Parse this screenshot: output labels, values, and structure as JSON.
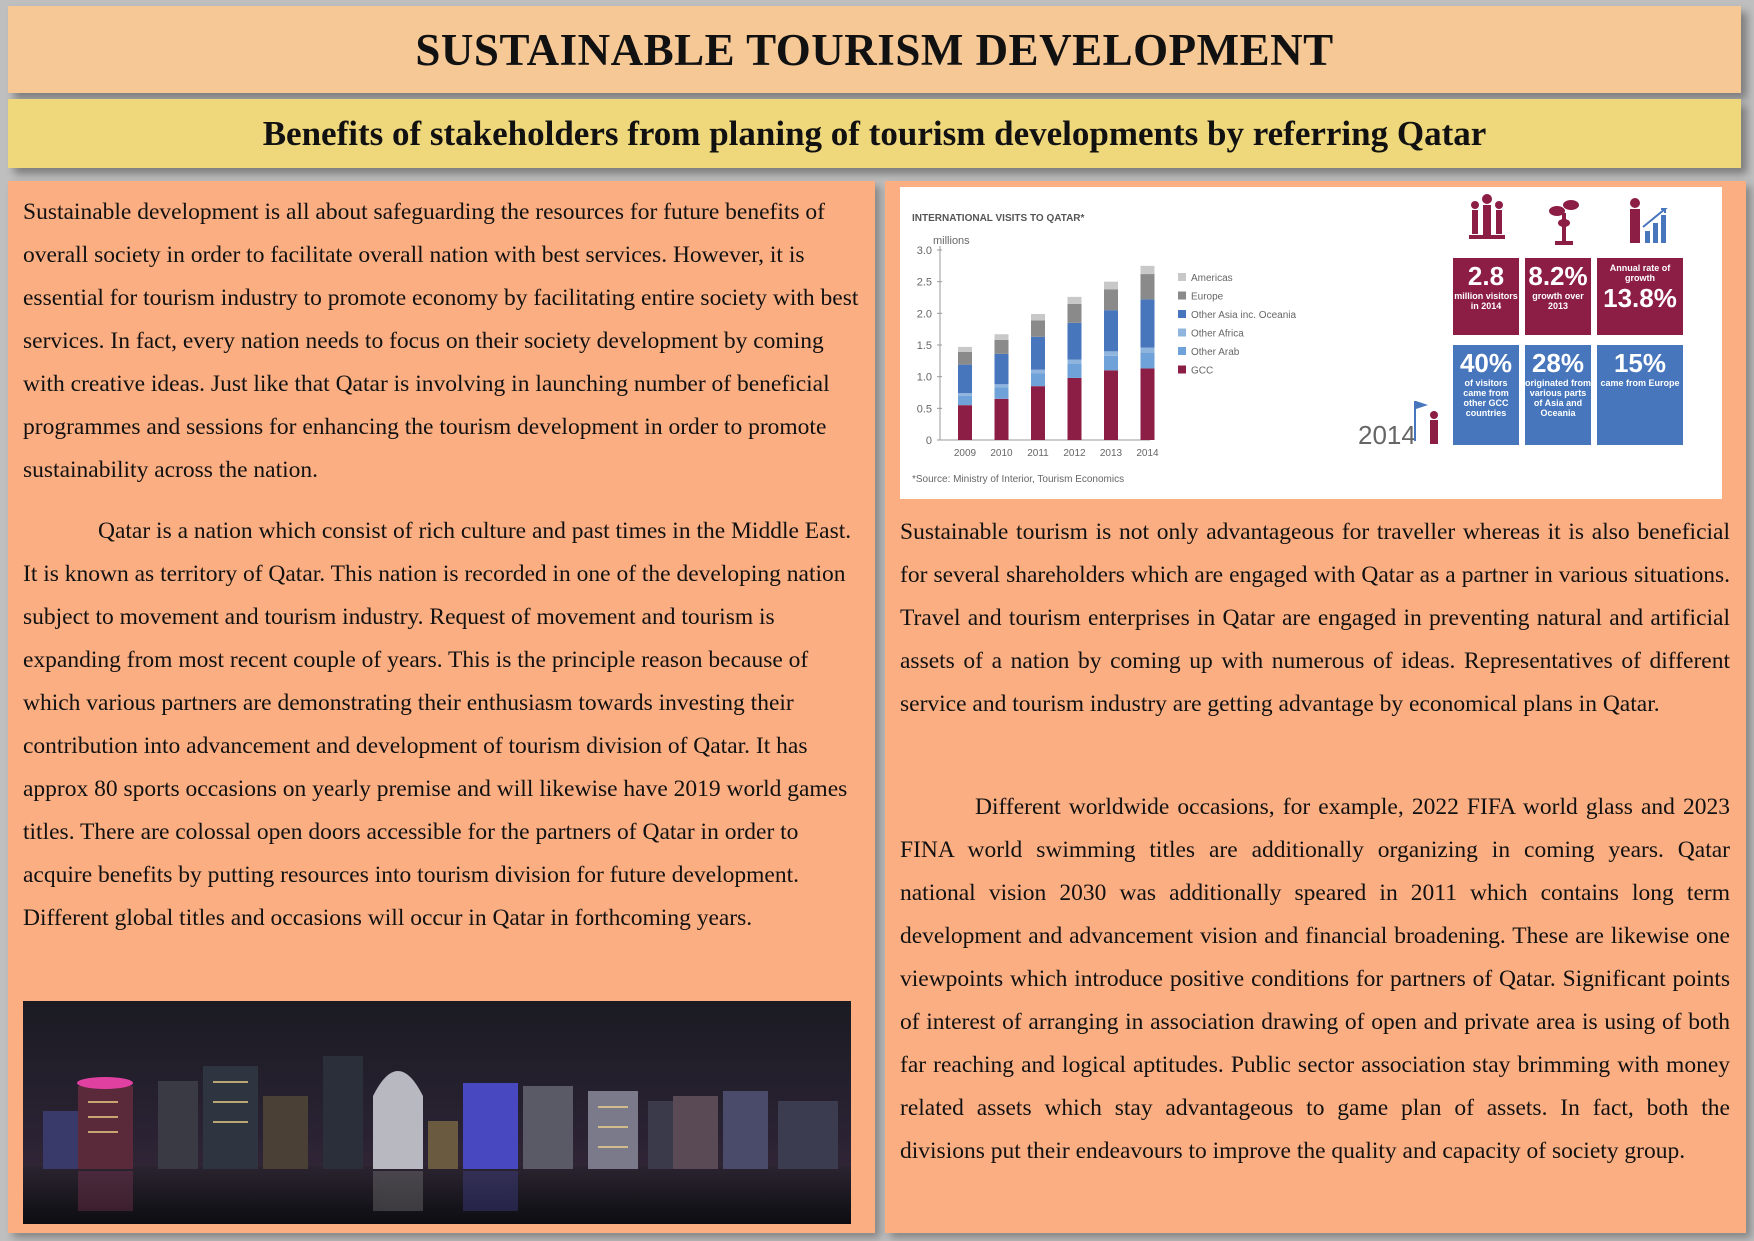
{
  "header": {
    "title": "SUSTAINABLE TOURISM DEVELOPMENT",
    "subtitle": "Benefits of stakeholders from planing of tourism developments by referring Qatar"
  },
  "left_column": {
    "paragraph1": "Sustainable development is all about safeguarding the resources for future benefits of overall society in order to facilitate overall nation with best services. However, it is essential for tourism industry to promote economy by facilitating entire society with best services. In fact, every nation needs to focus on their society development by coming with creative ideas. Just like that Qatar is involving in launching number of beneficial programmes and sessions for enhancing the tourism development in order to promote sustainability across the nation.",
    "paragraph2": "Qatar is a nation which consist of rich culture and past times in the Middle East. It is known as territory of Qatar. This nation is recorded in one of the developing nation subject to movement and tourism industry. Request of movement and tourism is expanding from most recent couple of years. This is the principle reason because of which various partners are demonstrating their enthusiasm towards investing their contribution into advancement and development of tourism division of Qatar. It has approx 80 sports occasions on yearly premise and will likewise have 2019 world games titles. There are colossal open doors accessible for the partners of Qatar in order to acquire benefits by putting resources into tourism division for future  development. Different global titles and occasions will occur in Qatar in forthcoming years."
  },
  "right_column": {
    "paragraph1": "Sustainable tourism is not only advantageous for traveller whereas it is also beneficial for several shareholders which are engaged with Qatar as a partner in various situations. Travel and tourism enterprises in Qatar are engaged in preventing natural and artificial assets of a nation by coming up with numerous of ideas. Representatives of different service and tourism industry are getting advantage by economical plans in Qatar.",
    "paragraph2": "Different worldwide occasions, for example, 2022 FIFA world glass and 2023 FINA world swimming titles are additionally organizing in coming years. Qatar national vision 2030 was additionally speared in 2011 which contains long term development and advancement vision and financial broadening. These are likewise one viewpoints which introduce positive conditions for partners of Qatar. Significant points of interest of arranging in association drawing of open and private area is using of both far reaching and logical aptitudes. Public sector association stay brimming with money related assets which stay advantageous to game plan of assets. In fact, both the divisions put their endeavours to improve the quality and capacity of society group."
  },
  "chart_data": {
    "type": "bar",
    "stacked": true,
    "title": "INTERNATIONAL VISITS TO QATAR*",
    "ylabel": "millions",
    "ylim": [
      0,
      3.0
    ],
    "yticks": [
      "3.0",
      "2.5",
      "2.0",
      "1.5",
      "1.0",
      "0.5",
      "0"
    ],
    "categories": [
      "2009",
      "2010",
      "2011",
      "2012",
      "2013",
      "2014"
    ],
    "series": [
      {
        "name": "GCC",
        "color": "#8c1d44",
        "values": [
          0.55,
          0.65,
          0.85,
          0.98,
          1.1,
          1.13
        ]
      },
      {
        "name": "Other Arab",
        "color": "#6fa2d9",
        "values": [
          0.15,
          0.18,
          0.2,
          0.22,
          0.23,
          0.25
        ]
      },
      {
        "name": "Other Africa",
        "color": "#8fb4dd",
        "values": [
          0.04,
          0.05,
          0.06,
          0.07,
          0.07,
          0.08
        ]
      },
      {
        "name": "Other Asia inc. Oceania",
        "color": "#4776bd",
        "values": [
          0.45,
          0.48,
          0.52,
          0.58,
          0.65,
          0.76
        ]
      },
      {
        "name": "Europe",
        "color": "#8a8a8a",
        "values": [
          0.2,
          0.22,
          0.26,
          0.3,
          0.33,
          0.4
        ]
      },
      {
        "name": "Americas",
        "color": "#c8c8c8",
        "values": [
          0.08,
          0.09,
          0.1,
          0.11,
          0.12,
          0.13
        ]
      }
    ],
    "source": "*Source: Ministry of Interior, Tourism Economics"
  },
  "infographic": {
    "year": "2014",
    "tiles": [
      {
        "big": "2.8",
        "small": "million visitors in 2014",
        "color": "#8c1d44"
      },
      {
        "big": "8.2%",
        "small": "growth over 2013",
        "color": "#8c1d44"
      },
      {
        "big": "13.8%",
        "small": "Annual rate of growth",
        "color": "#8c1d44"
      },
      {
        "big": "40%",
        "small": "of visitors came from other GCC countries",
        "color": "#4776bd"
      },
      {
        "big": "28%",
        "small": "originated from various parts of Asia and Oceania",
        "color": "#4776bd"
      },
      {
        "big": "15%",
        "small": "came from Europe",
        "color": "#4776bd"
      }
    ]
  }
}
